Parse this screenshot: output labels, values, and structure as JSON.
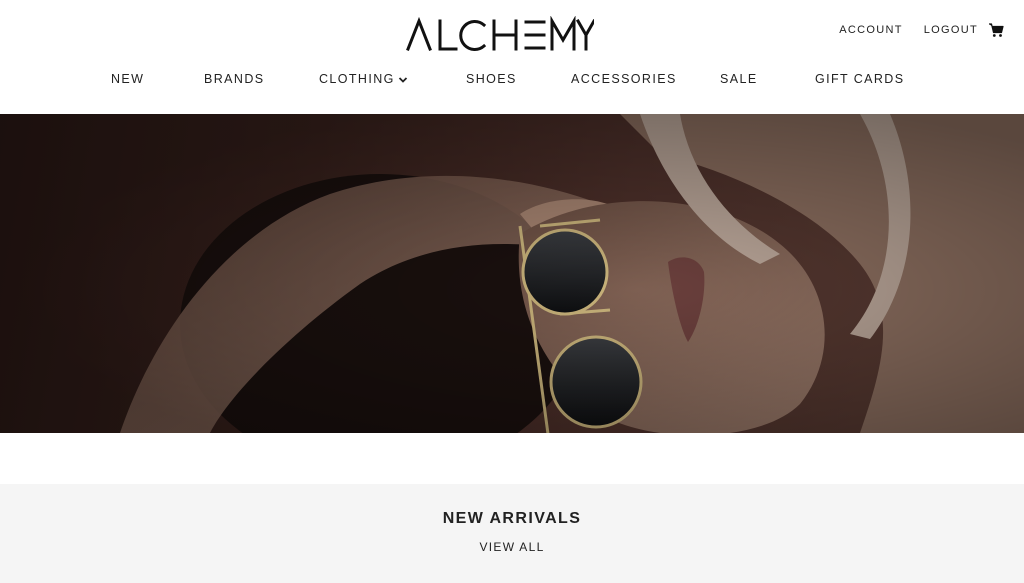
{
  "brand": {
    "logo_text": "ALCHEMY"
  },
  "utility_nav": {
    "account_label": "ACCOUNT",
    "logout_label": "LOGOUT",
    "cart_icon": "shopping-cart-icon"
  },
  "main_nav": {
    "items": [
      {
        "label": "NEW"
      },
      {
        "label": "BRANDS"
      },
      {
        "label": "CLOTHING",
        "has_dropdown": true
      },
      {
        "label": "SHOES"
      },
      {
        "label": "ACCESSORIES"
      },
      {
        "label": "SALE"
      },
      {
        "label": "GIFT CARDS"
      }
    ]
  },
  "hero": {
    "image_subject": "woman-with-round-sunglasses-lying-down"
  },
  "new_arrivals": {
    "title": "NEW ARRIVALS",
    "link_label": "VIEW ALL"
  },
  "colors": {
    "text": "#222222",
    "section_bg": "#f5f5f5",
    "page_bg": "#ffffff"
  }
}
